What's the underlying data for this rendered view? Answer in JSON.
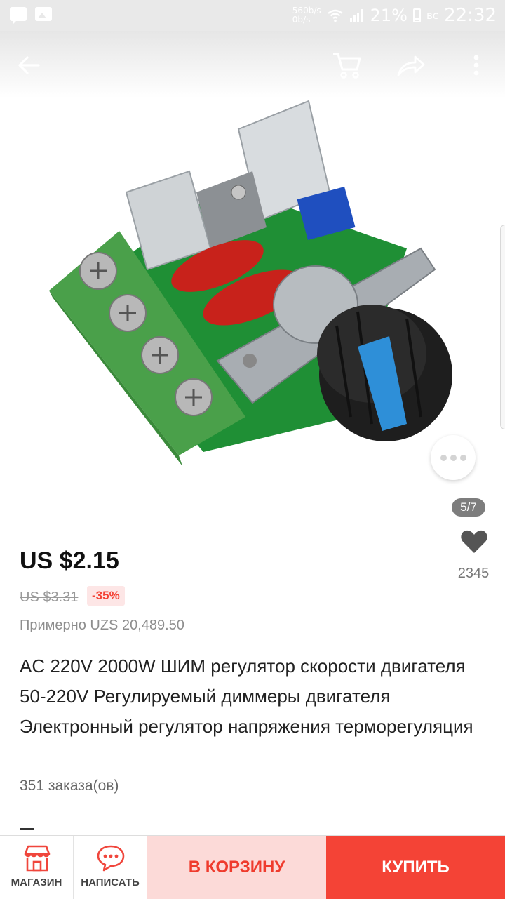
{
  "status_bar": {
    "net_up": "560b/s",
    "net_down": "0b/s",
    "battery": "21%",
    "day": "вс",
    "time": "22:32"
  },
  "gallery": {
    "pager": "5/7"
  },
  "product": {
    "price": "US $2.15",
    "old_price": "US $3.31",
    "discount": "-35%",
    "approx": "Примерно UZS 20,489.50",
    "title": "AC 220V 2000W ШИМ регулятор скорости двигателя 50-220V Регулируемый диммеры двигателя Электронный регулятор напряжения терморегуляция",
    "orders": "351 заказа(ов)",
    "wishlist_count": "2345"
  },
  "bottom_bar": {
    "store_label": "МАГАЗИН",
    "message_label": "НАПИСАТЬ",
    "add_to_cart": "В КОРЗИНУ",
    "buy": "КУПИТЬ"
  },
  "colors": {
    "accent": "#f44336",
    "cart_bg": "#fcdad8"
  },
  "icons": [
    "back-arrow-icon",
    "cart-icon",
    "share-icon",
    "more-vert-icon",
    "heart-icon",
    "store-icon",
    "chat-icon"
  ]
}
